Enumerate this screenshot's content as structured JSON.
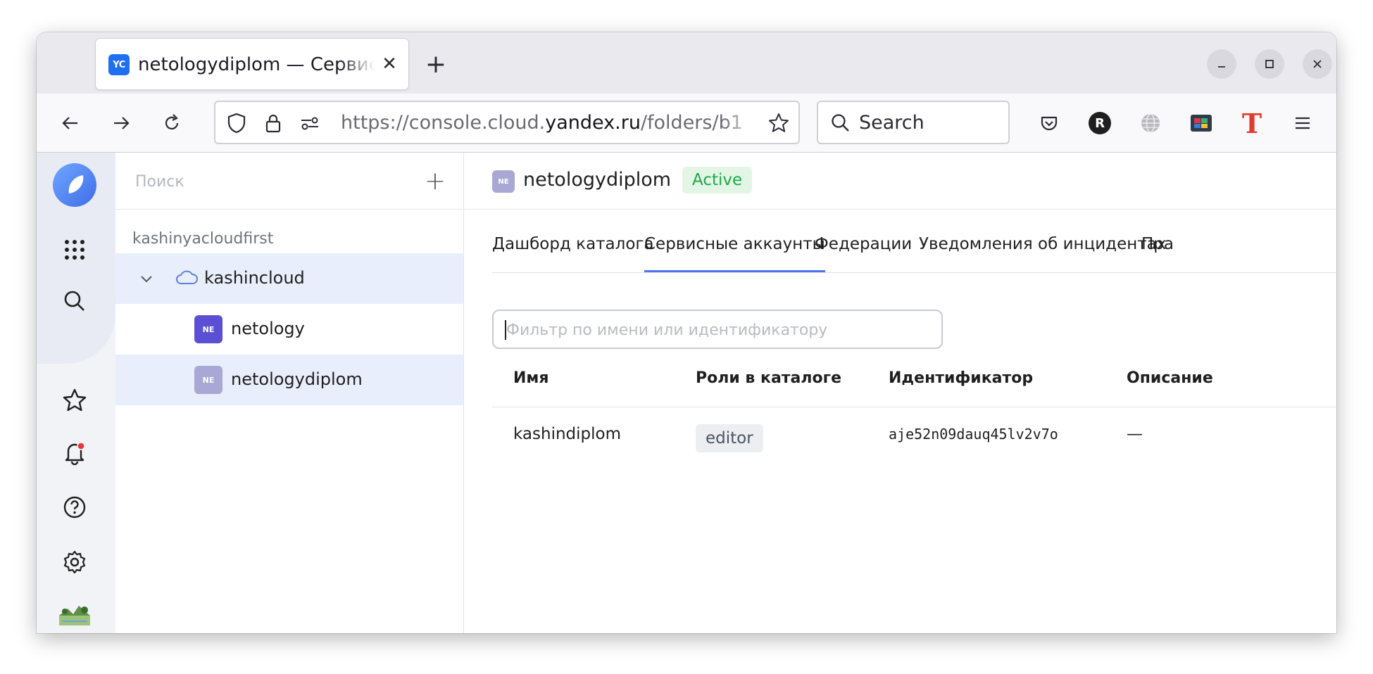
{
  "browser": {
    "tab_title": "netologydiplom — Сервисные аккаунты",
    "tab_favicon_text": "YC",
    "url_prefix": "https://console.cloud.",
    "url_domain": "yandex.ru",
    "url_suffix": "/folders/b1",
    "search_label": "Search",
    "extension_avatar_letter": "R",
    "extension_t_letter": "T"
  },
  "sidebar": {
    "search_placeholder": "Поиск",
    "cloud_label": "kashinyacloudfirst",
    "cloud_name": "kashincloud",
    "folders": [
      {
        "badge": "NE",
        "name": "netology",
        "badge_color": "#5b4fd6"
      },
      {
        "badge": "NE",
        "name": "netologydiplom",
        "badge_color": "#a9a7d4"
      }
    ]
  },
  "header": {
    "folder_badge": "NE",
    "folder_name": "netologydiplom",
    "status": "Active"
  },
  "tabs": [
    {
      "label": "Дашборд каталога",
      "active": false
    },
    {
      "label": "Сервисные аккаунты",
      "active": true
    },
    {
      "label": "Федерации",
      "active": false
    },
    {
      "label": "Уведомления об инцидентах",
      "active": false
    },
    {
      "label": "Пра",
      "active": false
    }
  ],
  "filter": {
    "placeholder": "Фильтр по имени или идентификатору"
  },
  "table": {
    "columns": [
      "Имя",
      "Роли в каталоге",
      "Идентификатор",
      "Описание"
    ],
    "rows": [
      {
        "name": "kashindiplom",
        "role": "editor",
        "id": "aje52n09dauq45lv2v7o",
        "description": "—"
      }
    ]
  },
  "colors": {
    "accent": "#4b75f0",
    "status_green": "#1ea84a"
  }
}
